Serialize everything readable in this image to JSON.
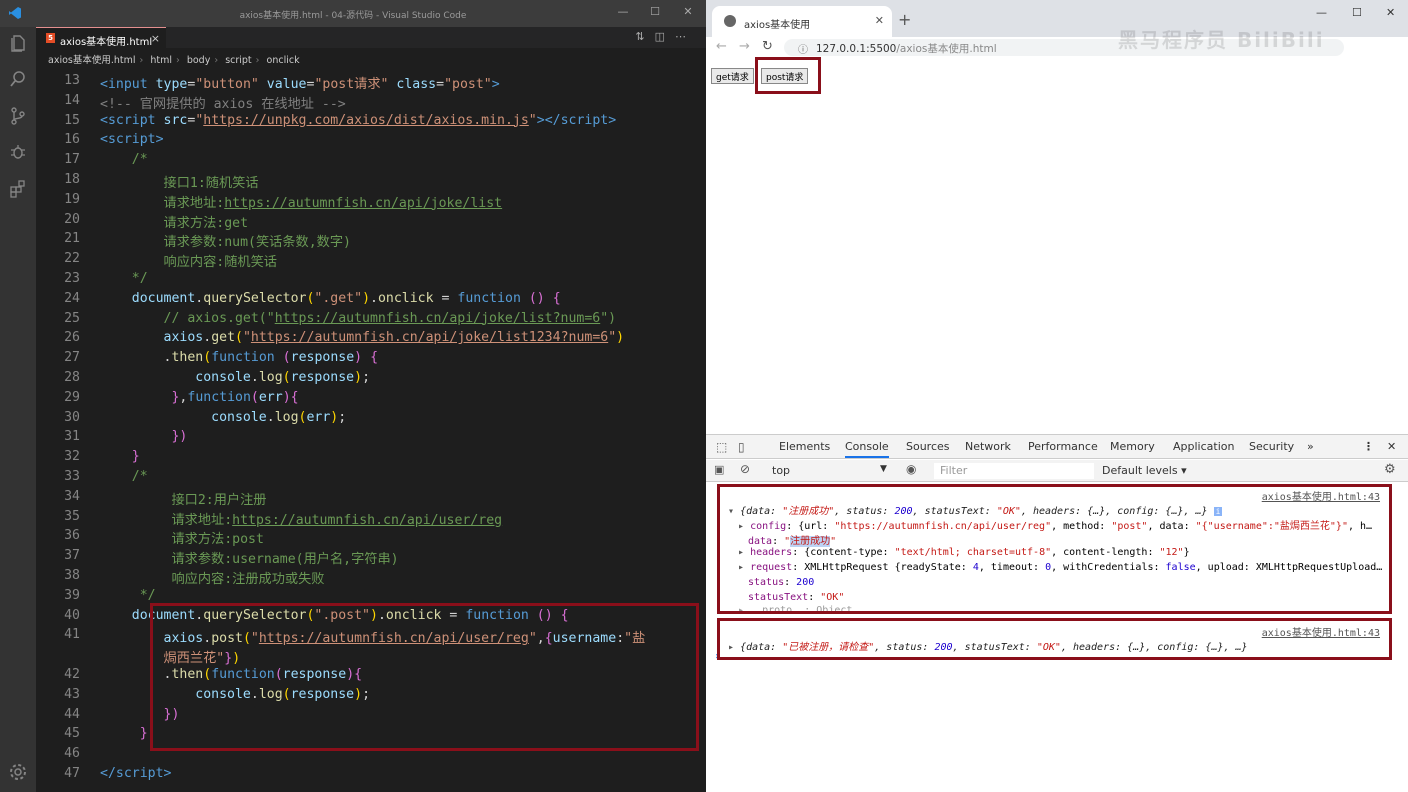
{
  "vscode": {
    "window_title": "axios基本使用.html - 04-源代码 - Visual Studio Code",
    "tab_label": "axios基本使用.html",
    "breadcrumbs": [
      "axios基本使用.html",
      "html",
      "body",
      "script",
      "onclick"
    ]
  },
  "code_lines": [
    {
      "n": "13",
      "html": "<span class='t'>&lt;input</span> <span class='a'>type</span>=<span class='s'>\"button\"</span> <span class='a'>value</span>=<span class='s'>\"post请求\"</span> <span class='a'>class</span>=<span class='s'>\"post\"</span><span class='t'>&gt;</span>"
    },
    {
      "n": "14",
      "html": "<span class='g'>&lt;!-- 官网提供的 axios 在线地址 --&gt;</span>"
    },
    {
      "n": "15",
      "html": "<span class='t'>&lt;script</span> <span class='a'>src</span>=<span class='s'>\"<span class='u'>https://unpkg.com/axios/dist/axios.min.js</span>\"</span><span class='t'>&gt;&lt;/script&gt;</span>"
    },
    {
      "n": "16",
      "html": "<span class='t'>&lt;script&gt;</span>"
    },
    {
      "n": "17",
      "html": "    <span class='c'>/*</span>"
    },
    {
      "n": "18",
      "html": "        <span class='c'>接口1:随机笑话</span>"
    },
    {
      "n": "19",
      "html": "        <span class='c'>请求地址:<span class='u'>https://autumnfish.cn/api/joke/list</span></span>"
    },
    {
      "n": "20",
      "html": "        <span class='c'>请求方法:get</span>"
    },
    {
      "n": "21",
      "html": "        <span class='c'>请求参数:num(笑话条数,数字)</span>"
    },
    {
      "n": "22",
      "html": "        <span class='c'>响应内容:随机笑话</span>"
    },
    {
      "n": "23",
      "html": "    <span class='c'>*/</span>"
    },
    {
      "n": "24",
      "html": "    <span class='a'>document</span>.<span class='f'>querySelector</span><span class='y'>(</span><span class='s'>\".get\"</span><span class='y'>)</span>.<span class='f'>onclick</span> = <span class='k'>function</span> <span class='m'>()</span> <span class='m'>{</span>"
    },
    {
      "n": "25",
      "html": "        <span class='c'>// axios.get(\"<span class='u'>https://autumnfish.cn/api/joke/list?num=6</span>\")</span>"
    },
    {
      "n": "26",
      "html": "        <span class='a'>axios</span>.<span class='f'>get</span><span class='y'>(</span><span class='s'>\"<span class='u'>https://autumnfish.cn/api/joke/list1234?num=6</span>\"</span><span class='y'>)</span>"
    },
    {
      "n": "27",
      "html": "        .<span class='f'>then</span><span class='y'>(</span><span class='k'>function</span> <span class='m'>(</span><span class='a'>response</span><span class='m'>)</span> <span class='m'>{</span>"
    },
    {
      "n": "28",
      "html": "            <span class='a'>console</span>.<span class='f'>log</span><span class='y'>(</span><span class='a'>response</span><span class='y'>)</span>;"
    },
    {
      "n": "29",
      "html": "         <span class='m'>}</span>,<span class='k'>function</span><span class='m'>(</span><span class='a'>err</span><span class='m'>){</span>"
    },
    {
      "n": "30",
      "html": "              <span class='a'>console</span>.<span class='f'>log</span><span class='y'>(</span><span class='a'>err</span><span class='y'>)</span>;"
    },
    {
      "n": "31",
      "html": "         <span class='m'>})</span>"
    },
    {
      "n": "32",
      "html": "    <span class='m'>}</span>"
    },
    {
      "n": "33",
      "html": "    <span class='c'>/*</span>"
    },
    {
      "n": "34",
      "html": "         <span class='c'>接口2:用户注册</span>"
    },
    {
      "n": "35",
      "html": "         <span class='c'>请求地址:<span class='u'>https://autumnfish.cn/api/user/reg</span></span>"
    },
    {
      "n": "36",
      "html": "         <span class='c'>请求方法:post</span>"
    },
    {
      "n": "37",
      "html": "         <span class='c'>请求参数:username(用户名,字符串)</span>"
    },
    {
      "n": "38",
      "html": "         <span class='c'>响应内容:注册成功或失败</span>"
    },
    {
      "n": "39",
      "html": "     <span class='c'>*/</span>"
    },
    {
      "n": "40",
      "html": "    <span class='a'>document</span>.<span class='f'>querySelector</span><span class='y'>(</span><span class='s'>\".post\"</span><span class='y'>)</span>.<span class='f'>onclick</span> = <span class='k'>function</span> <span class='m'>()</span> <span class='m'>{</span>"
    },
    {
      "n": "41",
      "html": "        <span class='a'>axios</span>.<span class='f'>post</span><span class='y'>(</span><span class='s'>\"<span class='u'>https://autumnfish.cn/api/user/reg</span>\"</span>,<span class='m'>{</span><span class='a'>username</span>:<span class='s'>\"盐</span>"
    },
    {
      "n": "",
      "html": "        <span class='s'>焗西兰花\"</span><span class='m'>}</span><span class='y'>)</span>"
    },
    {
      "n": "42",
      "html": "        .<span class='f'>then</span><span class='y'>(</span><span class='k'>function</span><span class='m'>(</span><span class='a'>response</span><span class='m'>){</span>"
    },
    {
      "n": "43",
      "html": "            <span class='a'>console</span>.<span class='f'>log</span><span class='y'>(</span><span class='a'>response</span><span class='y'>)</span>;"
    },
    {
      "n": "44",
      "html": "        <span class='m'>})</span>"
    },
    {
      "n": "45",
      "html": "     <span class='m'>}</span>"
    },
    {
      "n": "46",
      "html": ""
    },
    {
      "n": "47",
      "html": "<span class='t'>&lt;/script&gt;</span>"
    }
  ],
  "browser": {
    "tab_title": "axios基本使用",
    "url_host": "127.0.0.1:5500",
    "url_path": "/axios基本使用.html",
    "get_button": "get请求",
    "post_button": "post请求",
    "watermark": "黑马程序员 BiliBili"
  },
  "devtools": {
    "tabs": [
      "Elements",
      "Console",
      "Sources",
      "Network",
      "Performance",
      "Memory",
      "Application",
      "Security"
    ],
    "more": "»",
    "context": "top",
    "filter_placeholder": "Filter",
    "levels": "Default levels ▾",
    "source1": "axios基本使用.html:43",
    "source2": "axios基本使用.html:43"
  }
}
